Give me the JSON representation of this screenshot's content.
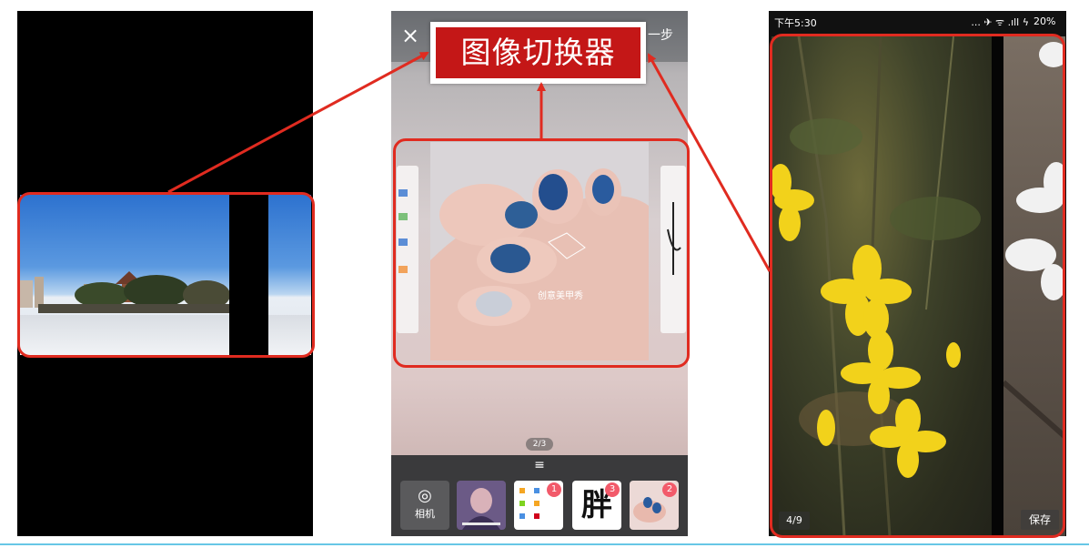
{
  "callout": {
    "label": "图像切换器"
  },
  "phone2": {
    "close_glyph": "×",
    "next_label": "一步",
    "page_counter": "2/3",
    "handle_glyph": "≡",
    "camera": {
      "glyph": "◎",
      "label": "相机"
    },
    "watermark": "创意美甲秀",
    "thumbnails": [
      {
        "name": "portrait-photo",
        "badge": ""
      },
      {
        "name": "app-screenshot",
        "badge": "1"
      },
      {
        "name": "calligraphy",
        "text": "胖",
        "badge": "3"
      },
      {
        "name": "nail-photo",
        "badge": "2"
      }
    ]
  },
  "phone3": {
    "status_time": "下午5:30",
    "status_icons": "... ✈ ᯤ .ıll ϟ",
    "battery": "20%",
    "page_counter": "4/9",
    "save_label": "保存"
  },
  "colors": {
    "highlight_red": "#e02b20",
    "callout_red": "#c41717",
    "badge_pink": "#f25a6a"
  }
}
